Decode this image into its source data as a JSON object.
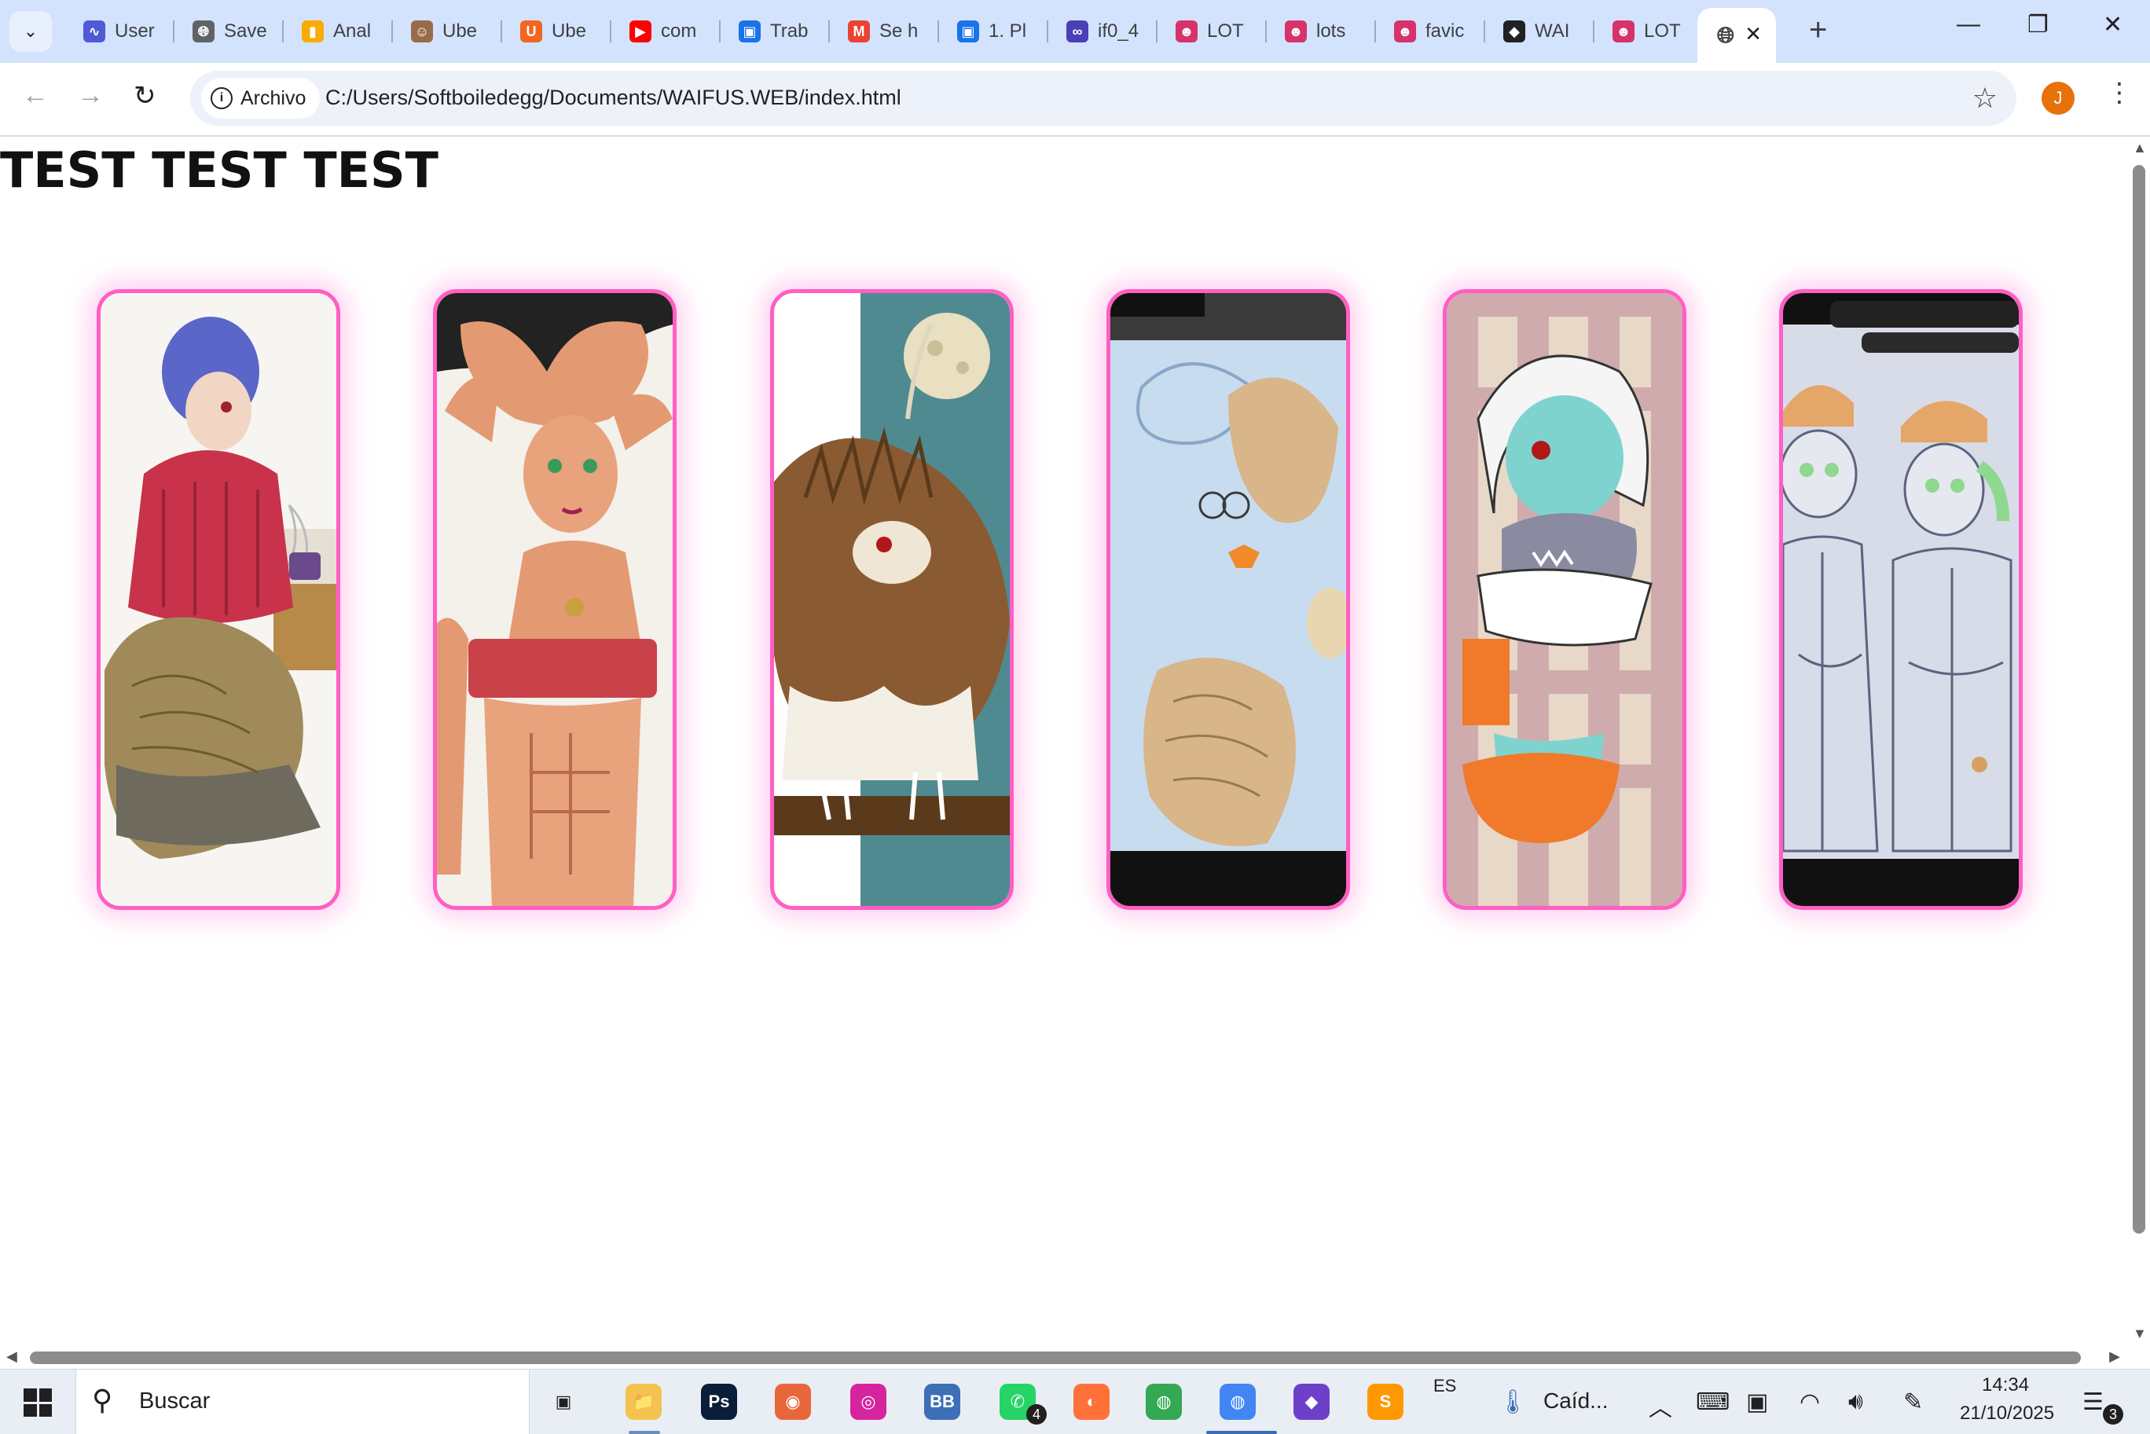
{
  "browser": {
    "tabs": [
      {
        "title": "User",
        "icon": "swirl-icon",
        "color": "#4f5bd5"
      },
      {
        "title": "Save",
        "icon": "globe-icon",
        "color": "#5f6368"
      },
      {
        "title": "Anal",
        "icon": "analytics-icon",
        "color": "#f9ab00"
      },
      {
        "title": "Ube",
        "icon": "face-icon",
        "color": "#9a6b4a"
      },
      {
        "title": "Ube",
        "icon": "u-icon",
        "color": "#f26522"
      },
      {
        "title": "com",
        "icon": "youtube-icon",
        "color": "#ff0000"
      },
      {
        "title": "Trab",
        "icon": "classroom-icon",
        "color": "#1a73e8"
      },
      {
        "title": "Se h",
        "icon": "gmail-icon",
        "color": "#ea4335"
      },
      {
        "title": "1. Pl",
        "icon": "classroom-icon",
        "color": "#1a73e8"
      },
      {
        "title": "if0_4",
        "icon": "infinity-icon",
        "color": "#4b3fb5"
      },
      {
        "title": "LOT",
        "icon": "lots-icon",
        "color": "#d6336c"
      },
      {
        "title": "lots",
        "icon": "lots-icon",
        "color": "#d6336c"
      },
      {
        "title": "favic",
        "icon": "lots-icon",
        "color": "#d6336c"
      },
      {
        "title": "WAI",
        "icon": "github-icon",
        "color": "#202124"
      },
      {
        "title": "LOT",
        "icon": "lots-icon",
        "color": "#d6336c"
      }
    ],
    "active_tab": {
      "icon": "globe-icon",
      "close": "✕"
    },
    "new_tab": "+",
    "window_controls": {
      "minimize": "—",
      "restore": "❐",
      "close": "✕"
    },
    "nav": {
      "back": "←",
      "forward": "→",
      "reload": "↻"
    },
    "address": {
      "chip_label": "Archivo",
      "url": "C:/Users/Softboiledegg/Documents/WAIFUS.WEB/index.html",
      "bookmark": "☆"
    },
    "profile_initial": "J",
    "menu": "⋮"
  },
  "page": {
    "title": "TEST TEST TEST",
    "accent_color": "#ff5ec4",
    "cards": [
      {
        "subject": "mermaid in red sweater with purple hair",
        "palette": [
          "#c8324a",
          "#5a66c8",
          "#a08a5a"
        ]
      },
      {
        "subject": "tan muscular girl with red top",
        "palette": [
          "#e39a72",
          "#c9424a",
          "#f4f0ea"
        ]
      },
      {
        "subject": "furry owl-like creature under the moon",
        "palette": [
          "#8a5a32",
          "#4f8a90",
          "#e8e0c0"
        ]
      },
      {
        "subject": "sketch mermaid with orange bikini on paper",
        "palette": [
          "#c8dcef",
          "#d9b58a",
          "#3a3a3a"
        ]
      },
      {
        "subject": "teal girl holding shark plush",
        "palette": [
          "#7fd3cf",
          "#f07a2a",
          "#c9a0a8"
        ]
      },
      {
        "subject": "two girls with beanies sketch on paper",
        "palette": [
          "#d8dce8",
          "#e5a66a",
          "#8fd88f"
        ]
      }
    ]
  },
  "taskbar": {
    "search_placeholder": "Buscar",
    "apps": [
      {
        "name": "task-view-icon",
        "label": "▣",
        "color": "#202020"
      },
      {
        "name": "file-explorer-icon",
        "label": "📁",
        "color": "#f3c24f"
      },
      {
        "name": "photoshop-icon",
        "label": "Ps",
        "color": "#0a1e3a"
      },
      {
        "name": "eye-app-icon",
        "label": "◉",
        "color": "#e8673a"
      },
      {
        "name": "instagram-icon",
        "label": "◎",
        "color": "#d6249f"
      },
      {
        "name": "pso-bb-icon",
        "label": "BB",
        "color": "#3d6fb6"
      },
      {
        "name": "whatsapp-icon",
        "label": "✆",
        "color": "#25d366"
      },
      {
        "name": "firefox-icon",
        "label": "◐",
        "color": "#ff7139"
      },
      {
        "name": "chrome-icon",
        "label": "◍",
        "color": "#34a853"
      },
      {
        "name": "chrome-active-icon",
        "label": "◍",
        "color": "#4285f4"
      },
      {
        "name": "github-desktop-icon",
        "label": "◆",
        "color": "#6e40c9"
      },
      {
        "name": "sublime-icon",
        "label": "S",
        "color": "#ff9800"
      }
    ],
    "whatsapp_badge": "4",
    "language": "ES",
    "weather": "Caíd...",
    "time": "14:34",
    "date": "21/10/2025",
    "notifications": "3"
  }
}
